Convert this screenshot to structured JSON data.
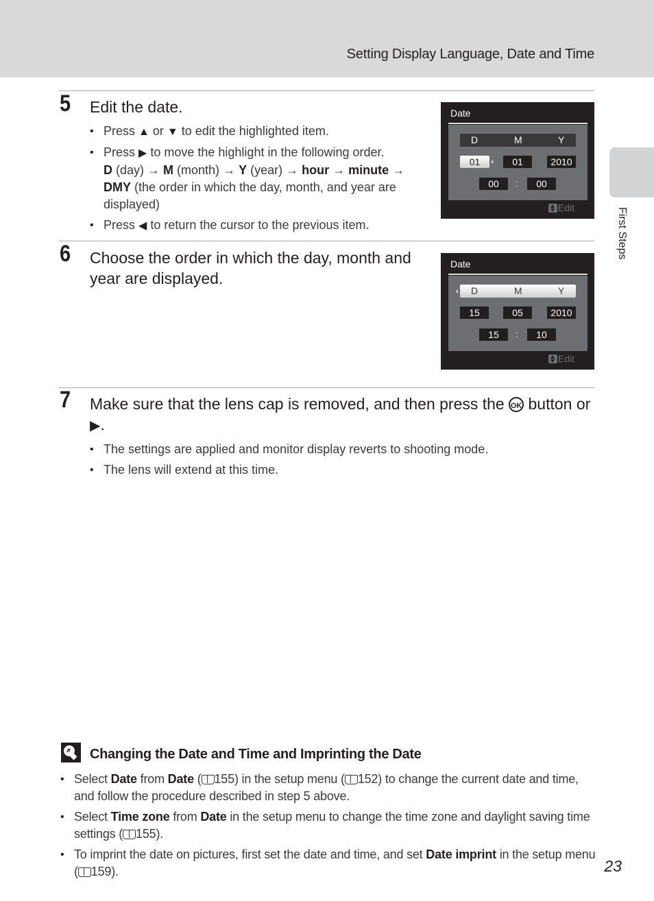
{
  "header": {
    "title": "Setting Display Language, Date and Time"
  },
  "side_tab": {
    "label": "First Steps"
  },
  "steps": [
    {
      "number": "5",
      "title": "Edit the date.",
      "bullets": {
        "b1_a": "Press",
        "b1_up": "▲",
        "b1_or": " or ",
        "b1_down": "▼",
        "b1_b": " to edit the highlighted item.",
        "b2_a": "Press",
        "b2_right": "▶",
        "b2_b": " to move the highlight in the following order.",
        "b2_d": "D",
        "b2_day": " (day) ",
        "b2_m": "M",
        "b2_month": " (month) ",
        "b2_y": "Y",
        "b2_year": " (year) ",
        "b2_hour": "hour",
        "b2_minute": "minute",
        "b2_dmy": "DMY",
        "b2_tail": " (the order in which the day, month, and year are displayed)",
        "arrow": "→",
        "b3_a": "Press",
        "b3_left": "◀",
        "b3_b": " to return the cursor to the previous item."
      },
      "screen": {
        "title": "Date",
        "headers": [
          "D",
          "M",
          "Y"
        ],
        "day": "01",
        "month": "01",
        "year": "2010",
        "hour": "00",
        "minute": "00",
        "colon": ":",
        "edit_label": "Edit",
        "highlighted": "day"
      }
    },
    {
      "number": "6",
      "title": "Choose the order in which the day, month and year are displayed.",
      "screen": {
        "title": "Date",
        "headers": [
          "D",
          "M",
          "Y"
        ],
        "day": "15",
        "month": "05",
        "year": "2010",
        "hour": "15",
        "minute": "10",
        "colon": ":",
        "edit_label": "Edit",
        "highlighted": "order"
      }
    },
    {
      "number": "7",
      "title_a": "Make sure that the lens cap is removed, and then press the",
      "ok": "OK",
      "title_b": " button or ",
      "title_right": "▶",
      "title_end": ".",
      "bullets": [
        "The settings are applied and monitor display reverts to shooting mode.",
        "The lens will extend at this time."
      ]
    }
  ],
  "note": {
    "title": "Changing the Date and Time and Imprinting the Date",
    "b1": {
      "t1": "Select ",
      "bold1": "Date",
      "t2": " from ",
      "bold2": "Date",
      "t3": " (",
      "ref1": "155",
      "t4": ") in the setup menu (",
      "ref2": "152",
      "t5": ") to change the current date and time, and follow the procedure described in step 5 above."
    },
    "b2": {
      "t1": "Select ",
      "bold1": "Time zone",
      "t2": " from ",
      "bold2": "Date",
      "t3": " in the setup menu to change the time zone and daylight saving time settings (",
      "ref1": "155",
      "t4": ")."
    },
    "b3": {
      "t1": "To imprint the date on pictures, first set the date and time, and set ",
      "bold1": "Date imprint",
      "t2": " in the setup menu (",
      "ref1": "159",
      "t3": ")."
    }
  },
  "page_number": "23"
}
